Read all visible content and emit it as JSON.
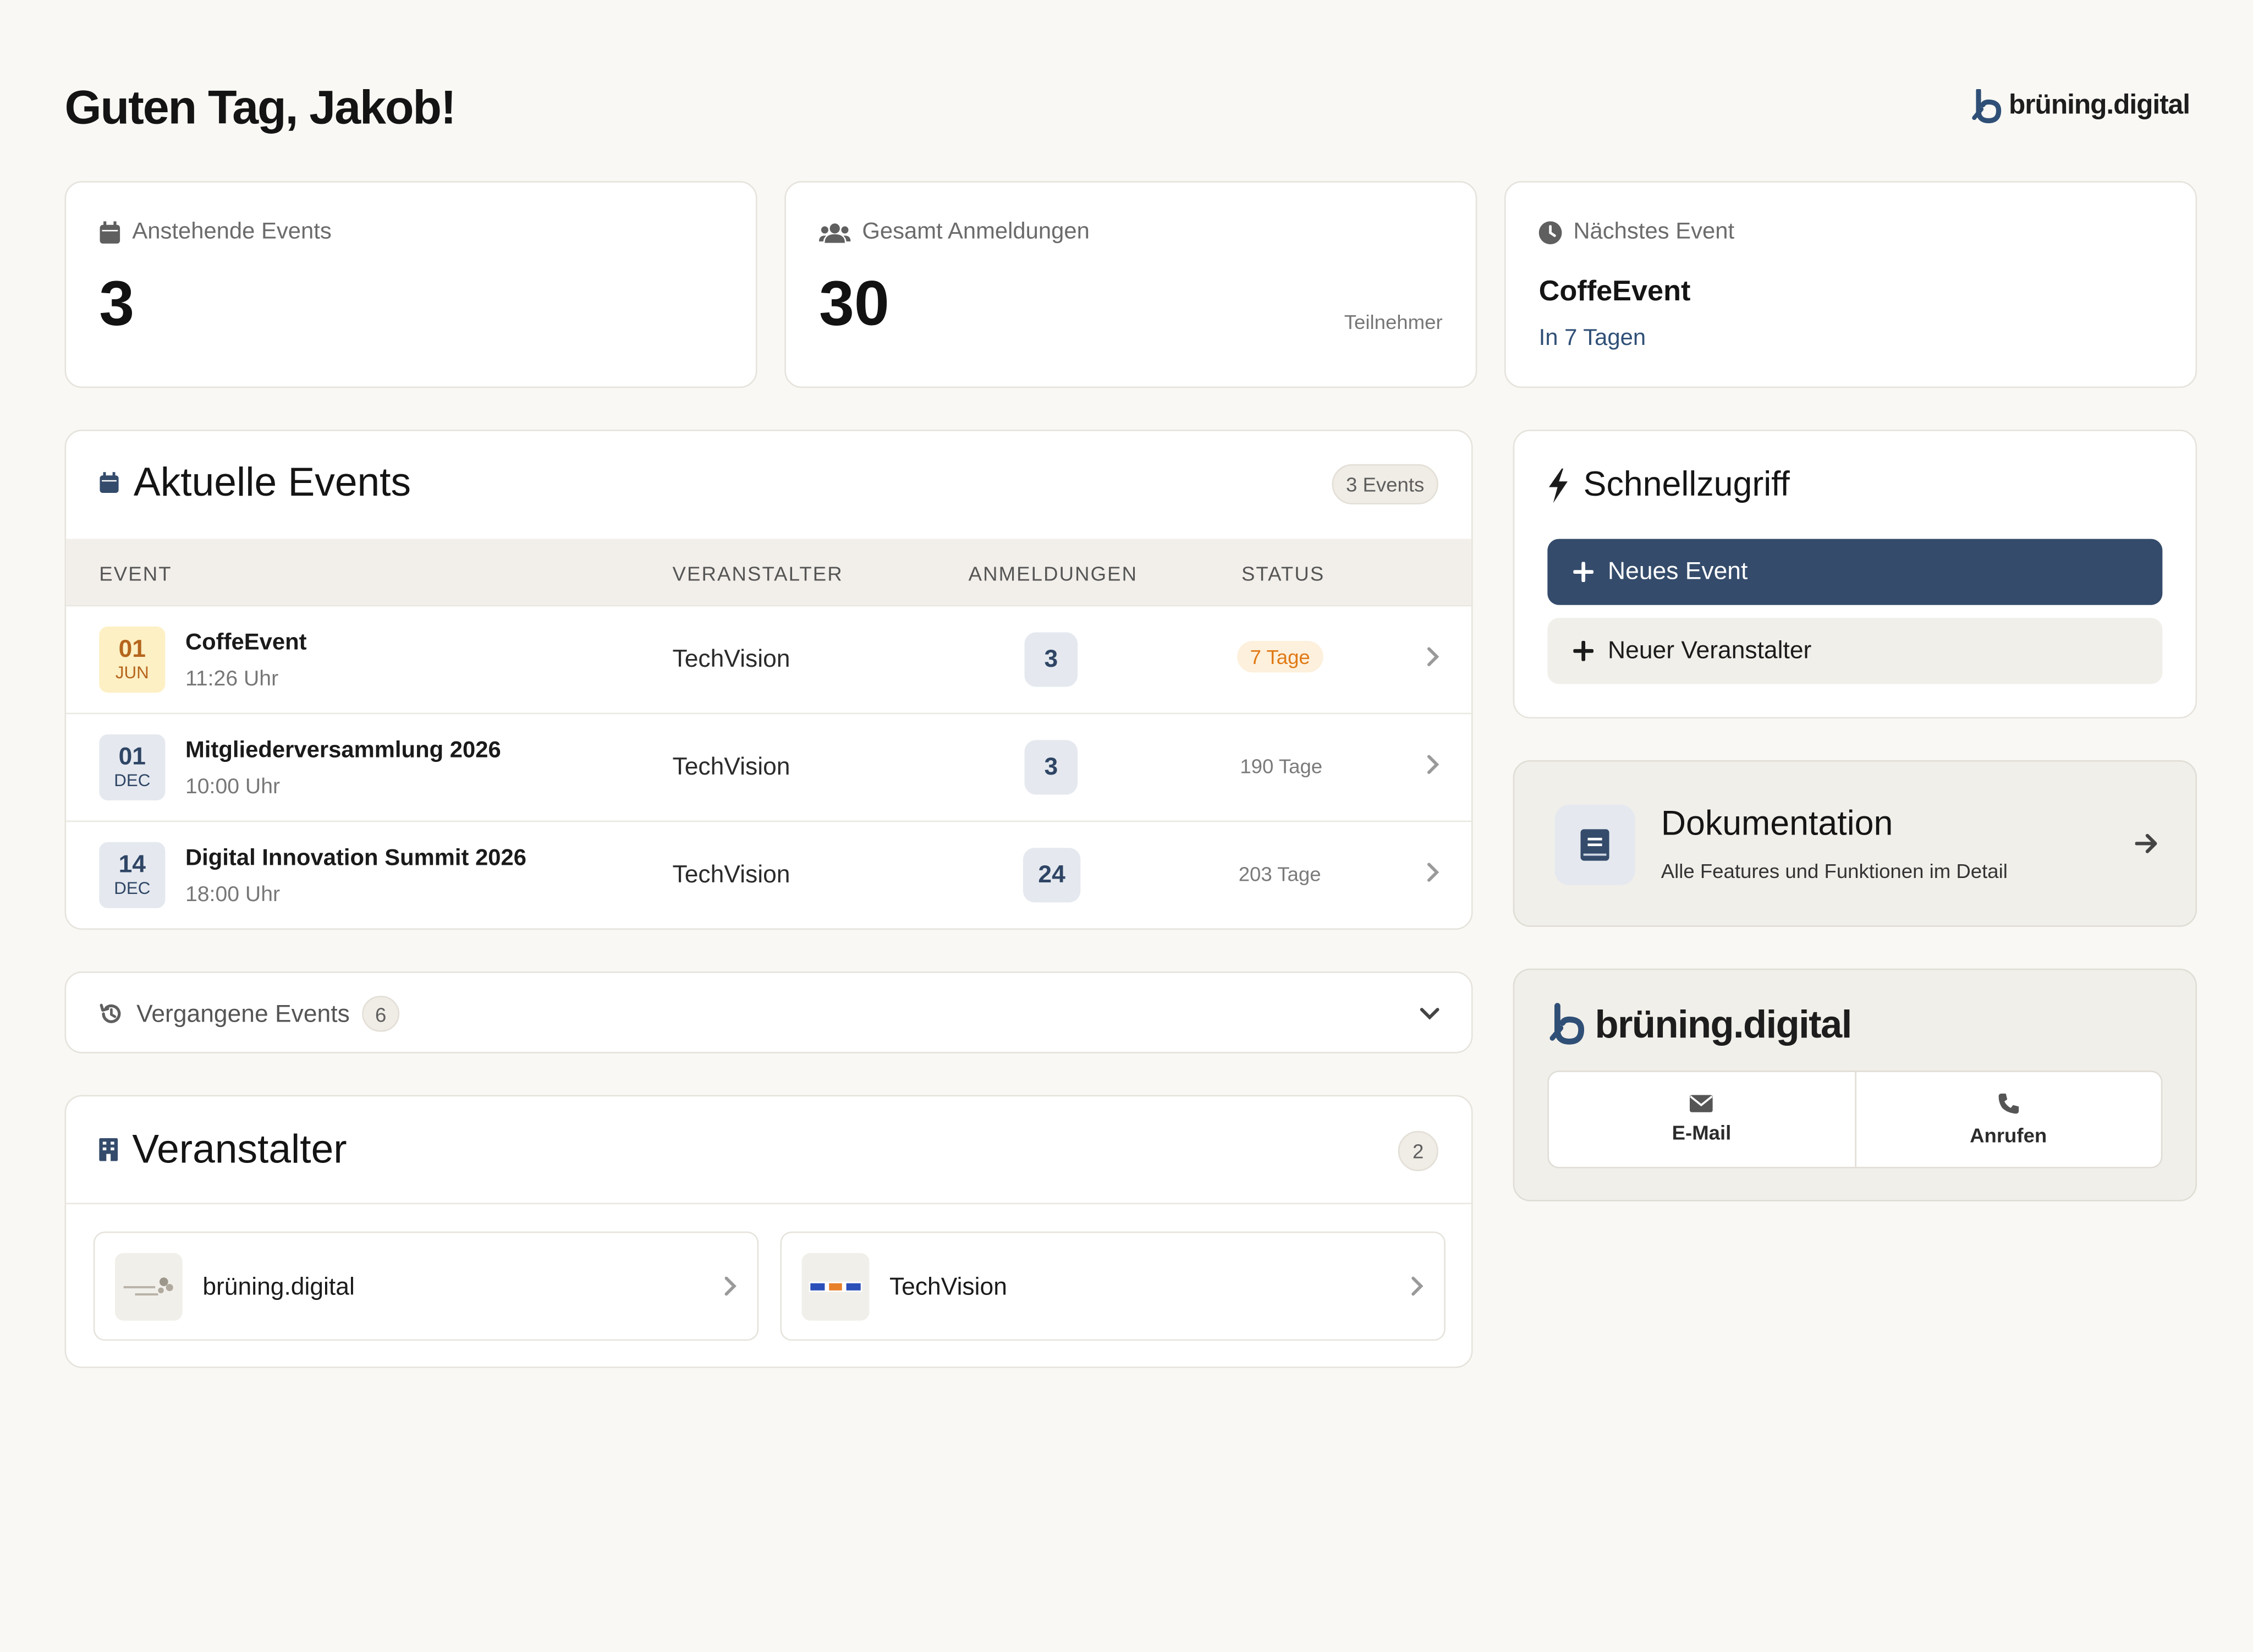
{
  "header": {
    "greeting": "Guten Tag, Jakob!",
    "brand": "brüning.digital"
  },
  "stats": {
    "upcoming_label": "Anstehende Events",
    "upcoming_value": "3",
    "registrations_label": "Gesamt Anmeldungen",
    "registrations_value": "30",
    "registrations_unit": "Teilnehmer",
    "next_label": "Nächstes Event",
    "next_title": "CoffeEvent",
    "next_sub": "In 7 Tagen"
  },
  "events": {
    "title": "Aktuelle Events",
    "count_label": "3 Events",
    "columns": [
      "EVENT",
      "VERANSTALTER",
      "ANMELDUNGEN",
      "STATUS"
    ],
    "rows": [
      {
        "day": "01",
        "month": "JUN",
        "name": "CoffeEvent",
        "time": "11:26 Uhr",
        "organizer": "TechVision",
        "registrations": "3",
        "status": "7 Tage"
      },
      {
        "day": "01",
        "month": "DEC",
        "name": "Mitgliederversammlung 2026",
        "time": "10:00 Uhr",
        "organizer": "TechVision",
        "registrations": "3",
        "status": "190 Tage"
      },
      {
        "day": "14",
        "month": "DEC",
        "name": "Digital Innovation Summit 2026",
        "time": "18:00 Uhr",
        "organizer": "TechVision",
        "registrations": "24",
        "status": "203 Tage"
      }
    ]
  },
  "past_events": {
    "label": "Vergangene Events",
    "count": "6"
  },
  "organizers": {
    "title": "Veranstalter",
    "count": "2",
    "items": [
      {
        "name": "brüning.digital"
      },
      {
        "name": "TechVision"
      }
    ]
  },
  "quick_access": {
    "title": "Schnellzugriff",
    "new_event": "Neues Event",
    "new_organizer": "Neuer Veranstalter"
  },
  "docs": {
    "title": "Dokumentation",
    "subtitle": "Alle Features und Funktionen im Detail"
  },
  "contact": {
    "brand": "brüning.digital",
    "email_label": "E-Mail",
    "call_label": "Anrufen"
  },
  "colors": {
    "accent": "#344b6b",
    "background": "#f9f8f4",
    "warning": "#e07a16",
    "warning_bg": "#fdf0dc",
    "highlight_date_bg": "#fdf0c4"
  },
  "icons": {
    "calendar": "calendar-icon",
    "users": "users-icon",
    "clock": "clock-icon",
    "bolt": "bolt-icon",
    "plus": "plus-icon",
    "book": "book-icon",
    "arrow": "arrow-right-icon",
    "history": "history-icon",
    "building": "building-icon",
    "mail": "mail-icon",
    "phone": "phone-icon",
    "chevron": "chevron-right-icon"
  }
}
